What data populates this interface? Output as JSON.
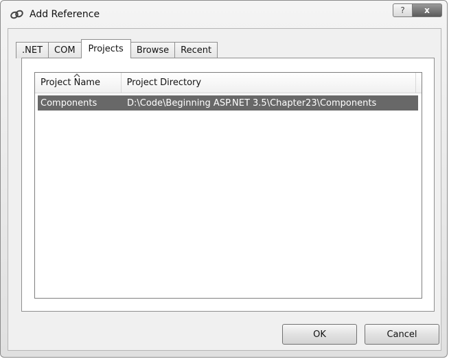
{
  "window": {
    "title": "Add Reference",
    "help_glyph": "?",
    "close_glyph": "x"
  },
  "tabs": [
    {
      "label": ".NET",
      "active": false
    },
    {
      "label": "COM",
      "active": false
    },
    {
      "label": "Projects",
      "active": true
    },
    {
      "label": "Browse",
      "active": false
    },
    {
      "label": "Recent",
      "active": false
    }
  ],
  "list": {
    "columns": [
      "Project Name",
      "Project Directory"
    ],
    "rows": [
      {
        "name": "Components",
        "directory": "D:\\Code\\Beginning ASP.NET 3.5\\Chapter23\\Components",
        "selected": true
      }
    ]
  },
  "buttons": {
    "ok": "OK",
    "cancel": "Cancel"
  }
}
